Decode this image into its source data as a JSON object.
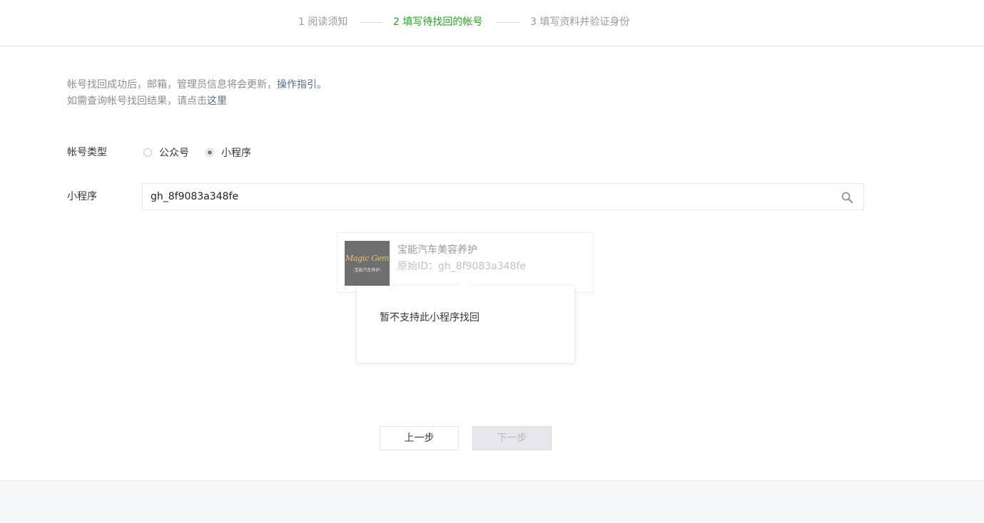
{
  "colors": {
    "accent": "#1aad19",
    "link": "#576b95",
    "muted": "#9a9a9a",
    "footer_bg": "#f6f7f9"
  },
  "steps": [
    {
      "label": "1 阅读须知",
      "active": false
    },
    {
      "label": "2 填写待找回的帐号",
      "active": true
    },
    {
      "label": "3 填写资料并验证身份",
      "active": false
    }
  ],
  "notice": {
    "line1_text": "帐号找回成功后，邮箱，管理员信息将会更新，",
    "line1_link": "操作指引。",
    "line2_text": "如需查询帐号找回结果，请点击",
    "line2_link": "这里"
  },
  "form": {
    "account_type_label": "帐号类型",
    "options": [
      "公众号",
      "小程序"
    ],
    "selected_option": "小程序",
    "miniprogram_label": "小程序",
    "search_value": "gh_8f9083a348fe",
    "search_icon": "search-icon"
  },
  "result": {
    "avatar_logo_text": "Magic Gem",
    "avatar_logo_sub": "-宝能汽车养护-",
    "name": "宝能汽车美容养护",
    "id_line": "原始ID：gh_8f9083a348fe"
  },
  "tooltip": {
    "message": "暂不支持此小程序找回"
  },
  "buttons": {
    "prev_label": "上一步",
    "next_label": "下一步"
  }
}
